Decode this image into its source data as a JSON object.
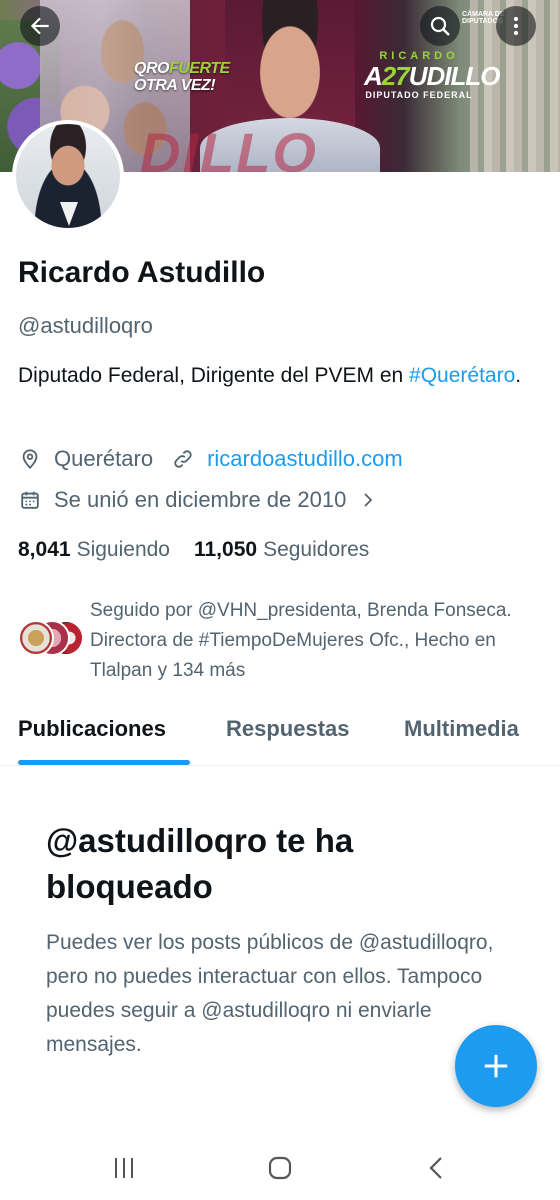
{
  "banner": {
    "slogan_line1": "QRO",
    "slogan_line2": "FUERTE",
    "slogan_line3": "OTRA",
    "slogan_line4": "VEZ!",
    "brand_first": "RICARDO",
    "brand_last_a": "A",
    "brand_last_27": "27",
    "brand_last_b": "UDILLO",
    "brand_sub": "DIPUTADO FEDERAL",
    "camara_line1": "CÁMARA DE",
    "camara_line2": "DIPUTADOS",
    "big_letters": "DILLO"
  },
  "header": {
    "back_icon": "arrow-left-icon",
    "search_icon": "search-icon",
    "more_icon": "more-vertical-icon"
  },
  "profile": {
    "name": "Ricardo Astudillo",
    "handle": "@astudilloqro",
    "bio_text": "Diputado Federal, Dirigente del PVEM en ",
    "bio_hashtag": "#Querétaro",
    "bio_end": ".",
    "location": "Querétaro",
    "website": "ricardoastudillo.com",
    "joined": "Se unió en diciembre de 2010",
    "following_count": "8,041",
    "following_label": "Siguiendo",
    "followers_count": "11,050",
    "followers_label": "Seguidores",
    "followed_by": "Seguido por @VHN_presidenta, Brenda Fonseca. Directora de #TiempoDeMujeres Ofc., Hecho en Tlalpan y 134 más"
  },
  "tabs": [
    {
      "label": "Publicaciones",
      "active": true
    },
    {
      "label": "Respuestas",
      "active": false
    },
    {
      "label": "Multimedia",
      "active": false
    }
  ],
  "blocked": {
    "title": "@astudilloqro te ha bloqueado",
    "body": "Puedes ver los posts públicos de @astudilloqro, pero no puedes interactuar con ellos. Tampoco puedes seguir a @astudilloqro ni enviarle mensajes."
  },
  "fab": {
    "icon": "plus-icon"
  },
  "colors": {
    "accent": "#1d9bf0",
    "text_primary": "#0f1419",
    "text_secondary": "#536471"
  }
}
